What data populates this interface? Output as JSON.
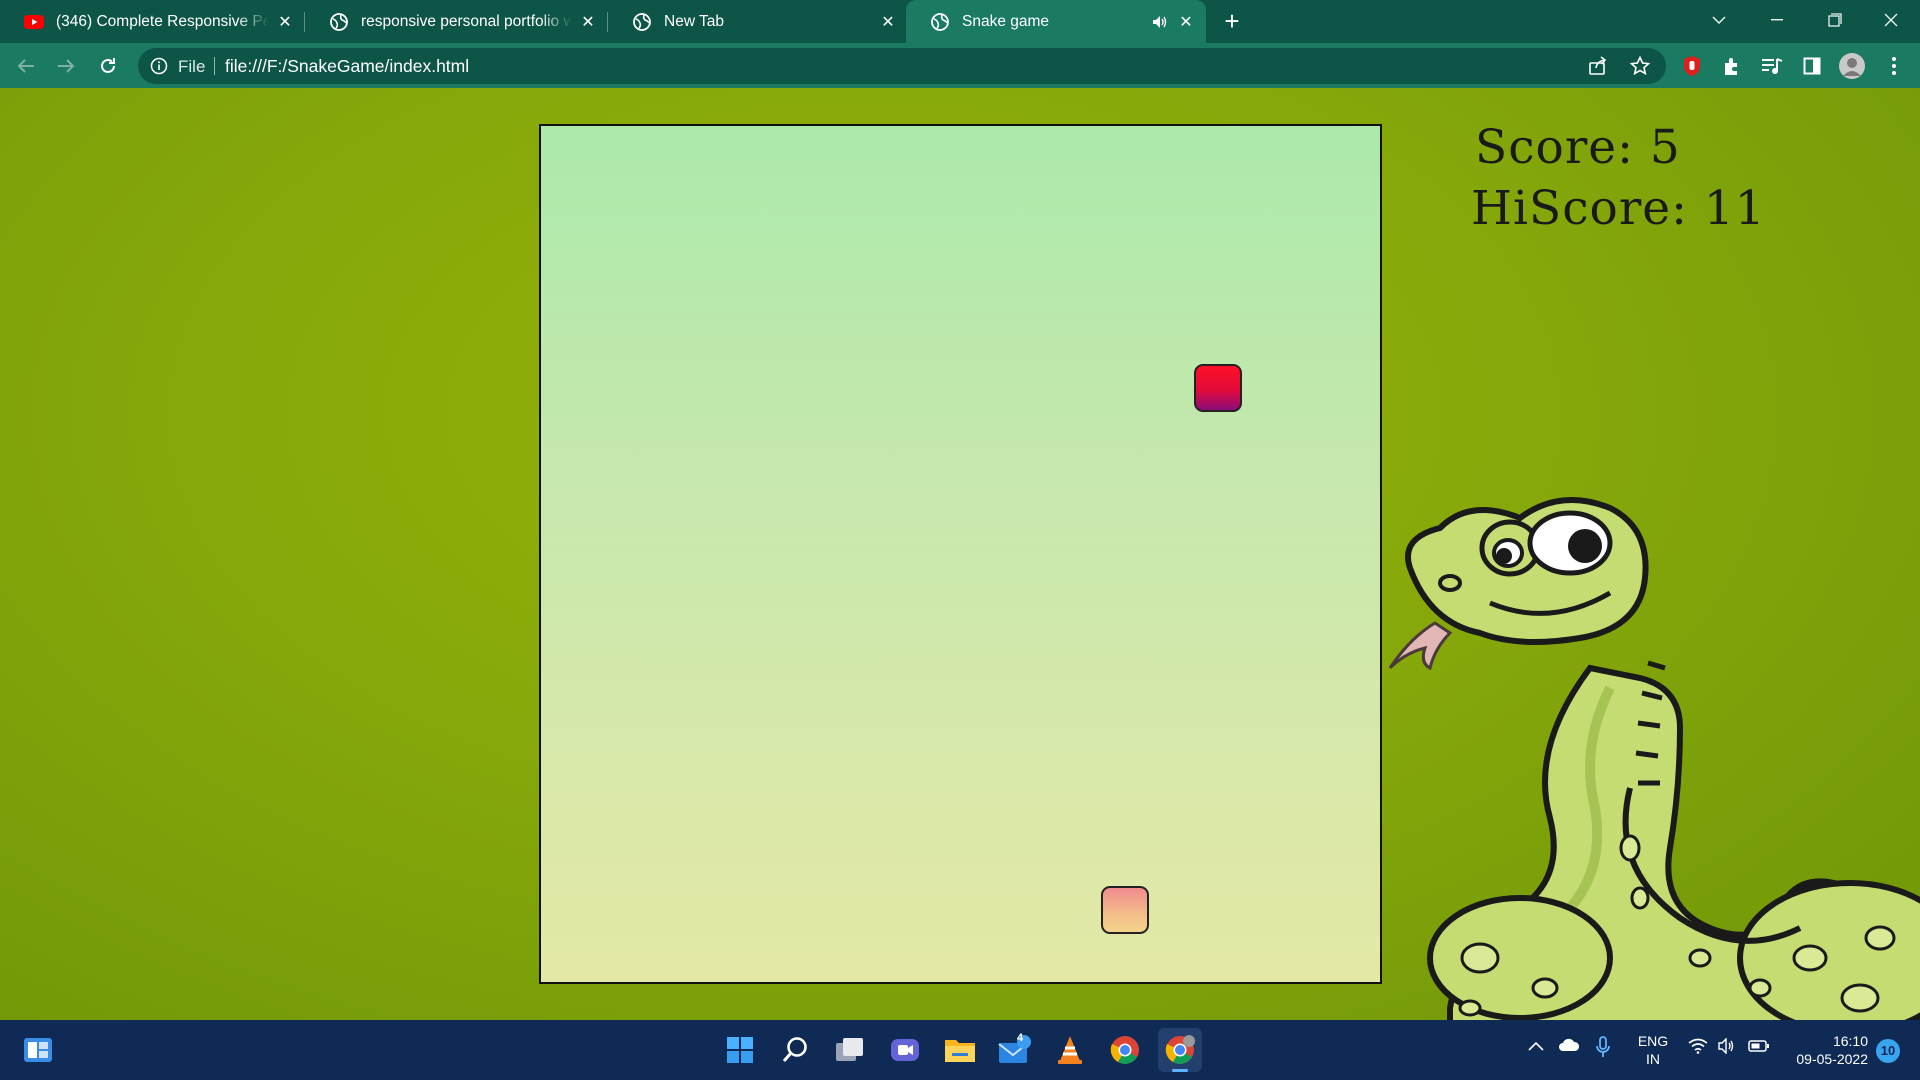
{
  "browser": {
    "tabs": [
      {
        "title": "(346) Complete Responsive Personal Portfolio",
        "favicon": "youtube-icon",
        "active": false
      },
      {
        "title": "responsive personal portfolio website",
        "favicon": "globe-icon",
        "active": false
      },
      {
        "title": "New Tab",
        "favicon": "globe-icon",
        "active": false
      },
      {
        "title": "Snake game",
        "favicon": "globe-icon",
        "active": true,
        "audio": true
      }
    ],
    "omnibox": {
      "scheme_label": "File",
      "url": "file:///F:/SnakeGame/index.html"
    }
  },
  "game": {
    "score_text": "Score: 5",
    "hiscore_text": "HiScore: 11"
  },
  "taskbar": {
    "apps": [
      "start-icon",
      "search-icon",
      "task-view-icon",
      "teams-chat-icon",
      "file-explorer-icon",
      "mail-icon",
      "vlc-icon",
      "chrome-icon",
      "chrome-profile-icon"
    ],
    "mail_badge": "4",
    "language": {
      "line1": "ENG",
      "line2": "IN"
    },
    "clock": {
      "time": "16:10",
      "date": "09-05-2022"
    },
    "notifications": "10"
  },
  "colors": {
    "browser_frame": "#0d5546",
    "toolbar": "#1a7a62",
    "page_background": "#86a80a",
    "board_top": "#abe9ab",
    "board_bottom": "#e4e8a6",
    "food": "#e10a3a",
    "snake_head": "#f4be8a",
    "taskbar": "#0f2a55"
  }
}
